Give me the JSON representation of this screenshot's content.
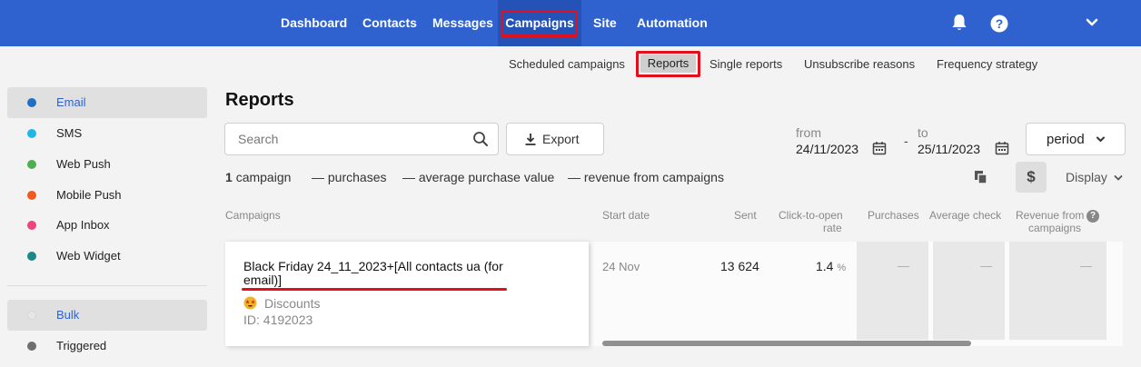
{
  "nav": {
    "items": [
      "Dashboard",
      "Contacts",
      "Messages",
      "Campaigns",
      "Site",
      "Automation"
    ],
    "active": "Campaigns",
    "icons": [
      "bell-icon",
      "help-circle-icon",
      "chevron-down-icon"
    ],
    "brand_color": "#2f62cf",
    "highlight_color": "#e0101d"
  },
  "subnav": {
    "items": [
      "Scheduled campaigns",
      "Reports",
      "Single reports",
      "Unsubscribe reasons",
      "Frequency strategy"
    ],
    "active": "Reports"
  },
  "sidebar": {
    "channels": [
      {
        "label": "Email",
        "color": "#1f6fc5",
        "active": true
      },
      {
        "label": "SMS",
        "color": "#1fb7e8",
        "active": false
      },
      {
        "label": "Web Push",
        "color": "#4caf50",
        "active": false
      },
      {
        "label": "Mobile Push",
        "color": "#f05a1e",
        "active": false
      },
      {
        "label": "App Inbox",
        "color": "#f0447c",
        "active": false
      },
      {
        "label": "Web Widget",
        "color": "#1a8a86",
        "active": false
      }
    ],
    "types": [
      {
        "label": "Bulk",
        "color": "#e6e6e6",
        "active": true
      },
      {
        "label": "Triggered",
        "color": "#6e6e6e",
        "active": false
      }
    ]
  },
  "main": {
    "title": "Reports",
    "search_placeholder": "Search",
    "export_label": "Export",
    "from_label": "from",
    "from_value": "24/11/2023",
    "to_label": "to",
    "to_value": "25/11/2023",
    "date_separator": "-",
    "period_label": "period",
    "summary": {
      "count": "1",
      "count_label": "campaign",
      "purchases": "— purchases",
      "avg_value": "— average purchase value",
      "revenue": "— revenue from campaigns"
    },
    "currency_symbol": "$",
    "display_label": "Display"
  },
  "table": {
    "headers": {
      "campaigns": "Campaigns",
      "start_date": "Start date",
      "sent": "Sent",
      "cto_line1": "Click-to-open",
      "cto_line2": "rate",
      "purchases": "Purchases",
      "avg_check": "Average check",
      "revenue_line1": "Revenue from",
      "revenue_line2": "campaigns"
    },
    "row": {
      "name": "Black Friday 24_11_2023+[All contacts ua (for email)]",
      "tag": "Discounts",
      "id": "ID: 4192023",
      "start_date": "24 Nov",
      "sent": "13 624",
      "cto": "1.4",
      "cto_unit": "%",
      "purchases": "—",
      "avg_check": "—",
      "revenue": "—"
    }
  }
}
